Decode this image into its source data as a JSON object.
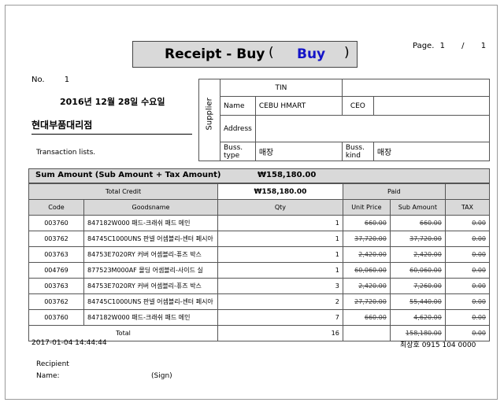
{
  "title": {
    "main": "Receipt - Buy",
    "open_paren": "(",
    "type": "Buy",
    "close_paren": ")"
  },
  "page": {
    "label": "Page.",
    "current": "1",
    "sep": "/",
    "total": "1"
  },
  "no": {
    "label": "No.",
    "value": "1"
  },
  "date": "2016년 12월 28일 수요일",
  "customer": "현대부품대리점",
  "transaction_label": "Transaction lists.",
  "supplier": {
    "side_label": "Supplier",
    "tin_label": "TIN",
    "tin_value": "",
    "name_label": "Name",
    "name_value": "CEBU HMART",
    "ceo_label": "CEO",
    "ceo_value": "",
    "address_label": "Address",
    "address_value": "",
    "buss_type_label": "Buss. type",
    "buss_type_value": "매장",
    "buss_kind_label": "Buss. kind",
    "buss_kind_value": "매장"
  },
  "sum": {
    "label": "Sum Amount (Sub Amount + Tax Amount)",
    "value": "₩158,180.00"
  },
  "credit": {
    "label": "Total Credit",
    "value": "₩158,180.00",
    "paid_label": "Paid",
    "paid_value": ""
  },
  "columns": [
    "Code",
    "Goodsname",
    "Qty",
    "Unit Price",
    "Sub Amount",
    "TAX"
  ],
  "rows": [
    {
      "code": "003760",
      "name": "847182W000 패드-크래쉬 패드 메인",
      "qty": "1",
      "unit": "660.00",
      "sub": "660.00",
      "tax": "0.00"
    },
    {
      "code": "003762",
      "name": "84745C1000UNS 판넬 어셈블리-센터 페시아",
      "qty": "1",
      "unit": "37,720.00",
      "sub": "37,720.00",
      "tax": "0.00"
    },
    {
      "code": "003763",
      "name": "84753E7020RY 커버 어셈블리-퓨즈 박스",
      "qty": "1",
      "unit": "2,420.00",
      "sub": "2,420.00",
      "tax": "0.00"
    },
    {
      "code": "004769",
      "name": "877523M000AF 몰딩 어셈블리-사이드 실",
      "qty": "1",
      "unit": "60,060.00",
      "sub": "60,060.00",
      "tax": "0.00"
    },
    {
      "code": "003763",
      "name": "84753E7020RY 커버 어셈블리-퓨즈 박스",
      "qty": "3",
      "unit": "2,420.00",
      "sub": "7,260.00",
      "tax": "0.00"
    },
    {
      "code": "003762",
      "name": "84745C1000UNS 판넬 어셈블리-센터 페시아",
      "qty": "2",
      "unit": "27,720.00",
      "sub": "55,440.00",
      "tax": "0.00"
    },
    {
      "code": "003760",
      "name": "847182W000 패드-크래쉬 패드 메인",
      "qty": "7",
      "unit": "660.00",
      "sub": "4,620.00",
      "tax": "0.00"
    }
  ],
  "total": {
    "label": "Total",
    "qty": "16",
    "sub": "158,180.00",
    "tax": "0.00"
  },
  "timestamp": "2017-01-04 14:44:44",
  "contact": "최상호 0915 104 0000",
  "recipient": {
    "label": "Recipient",
    "name_label": "Name:",
    "sign_label": "(Sign)"
  }
}
